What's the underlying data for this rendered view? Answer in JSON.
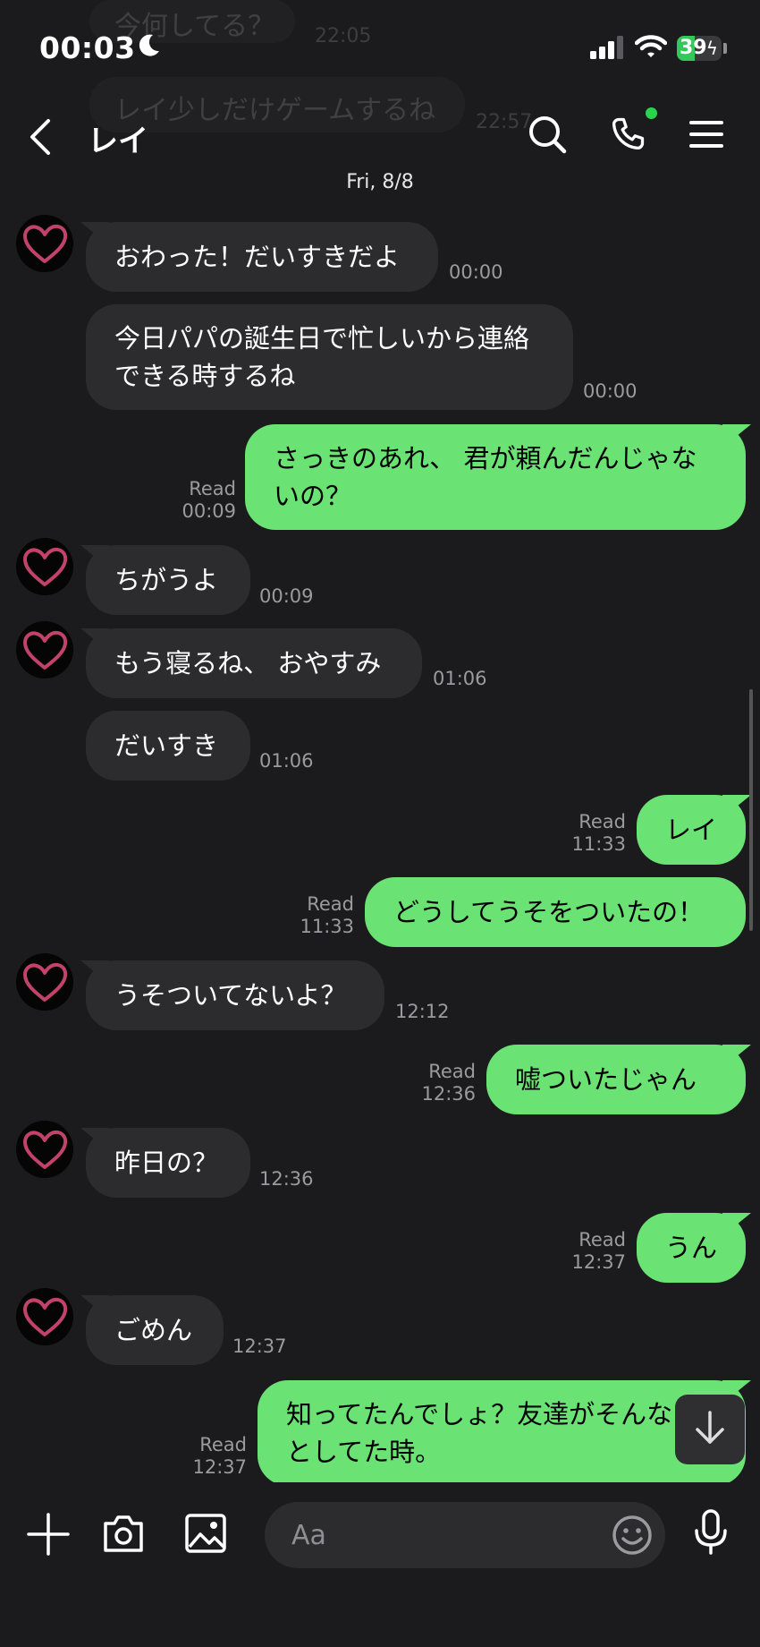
{
  "status": {
    "time": "00:03",
    "battery": "39",
    "battery_fraction": 0.39
  },
  "background_messages": [
    {
      "text": "今何してる？",
      "time": "22:05"
    },
    {
      "text": "レイ少しだけゲームするね",
      "time": "22:57"
    }
  ],
  "header": {
    "contact_name": "レイ"
  },
  "date_label": "Fri, 8/8",
  "messages": [
    {
      "dir": "in",
      "text": "おわった！だいすきだよ",
      "time": "00:00"
    },
    {
      "dir": "in",
      "text": "今日パパの誕生日で忙しいから連絡できる時するね",
      "time": "00:00"
    },
    {
      "dir": "out",
      "text": "さっきのあれ、 君が頼んだんじゃないの？",
      "read": "Read",
      "time": "00:09"
    },
    {
      "dir": "in",
      "text": "ちがうよ",
      "time": "00:09"
    },
    {
      "dir": "in",
      "text": "もう寝るね、 おやすみ",
      "time": "01:06"
    },
    {
      "dir": "in",
      "text": "だいすき",
      "time": "01:06"
    },
    {
      "dir": "out",
      "text": "レイ",
      "read": "Read",
      "time": "11:33"
    },
    {
      "dir": "out",
      "text": "どうしてうそをついたの！",
      "read": "Read",
      "time": "11:33"
    },
    {
      "dir": "in",
      "text": "うそついてないよ？",
      "time": "12:12"
    },
    {
      "dir": "out",
      "text": "嘘ついたじゃん",
      "read": "Read",
      "time": "12:36"
    },
    {
      "dir": "in",
      "text": "昨日の？",
      "time": "12:36"
    },
    {
      "dir": "out",
      "text": "うん",
      "read": "Read",
      "time": "12:37"
    },
    {
      "dir": "in",
      "text": "ごめん",
      "time": "12:37"
    },
    {
      "dir": "out",
      "text": "知ってたんでしょ？友達がそんなことしてた時。",
      "read": "Read",
      "time": "12:37"
    }
  ],
  "input": {
    "placeholder": "Aa"
  },
  "colors": {
    "background": "#1b1b1d",
    "outgoing_bubble": "#6ae274",
    "incoming_bubble": "#2c2c2e",
    "accent_green": "#2ad34c"
  }
}
